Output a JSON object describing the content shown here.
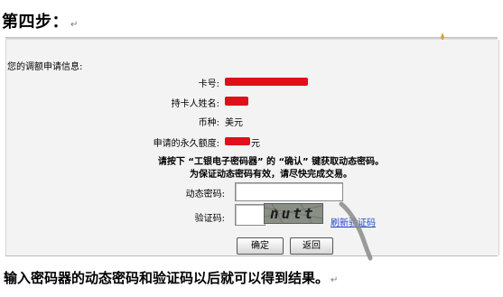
{
  "heading": {
    "text": "第四步：",
    "mark": "↵"
  },
  "form": {
    "caption": "您的调额申请信息:",
    "fields": [
      {
        "label": "卡号:",
        "value": "",
        "redacted": true
      },
      {
        "label": "持卡人姓名:",
        "value": "",
        "redacted": true
      },
      {
        "label": "币种:",
        "value": "美元",
        "redacted": false
      },
      {
        "label": "申请的永久额度:",
        "value": "元",
        "redacted": true
      }
    ],
    "notice_line1": "请按下 “工银电子密码器” 的 “确认” 键获取动态密码。",
    "notice_line2": "为保证动态密码有效，请尽快完成交易。",
    "dynamic_password": {
      "label": "动态密码:",
      "value": ""
    },
    "captcha": {
      "label": "验证码:",
      "value": "",
      "image_text": "nutt",
      "refresh_link": "刷新验证码"
    },
    "buttons": {
      "confirm": "确定",
      "back": "返回"
    }
  },
  "footer": {
    "text": "输入密码器的动态密码和验证码以后就可以得到结果。",
    "mark": "↵"
  },
  "colors": {
    "redaction": "#e0101a",
    "link": "#2244cc",
    "panel": "#f3f3f3"
  }
}
